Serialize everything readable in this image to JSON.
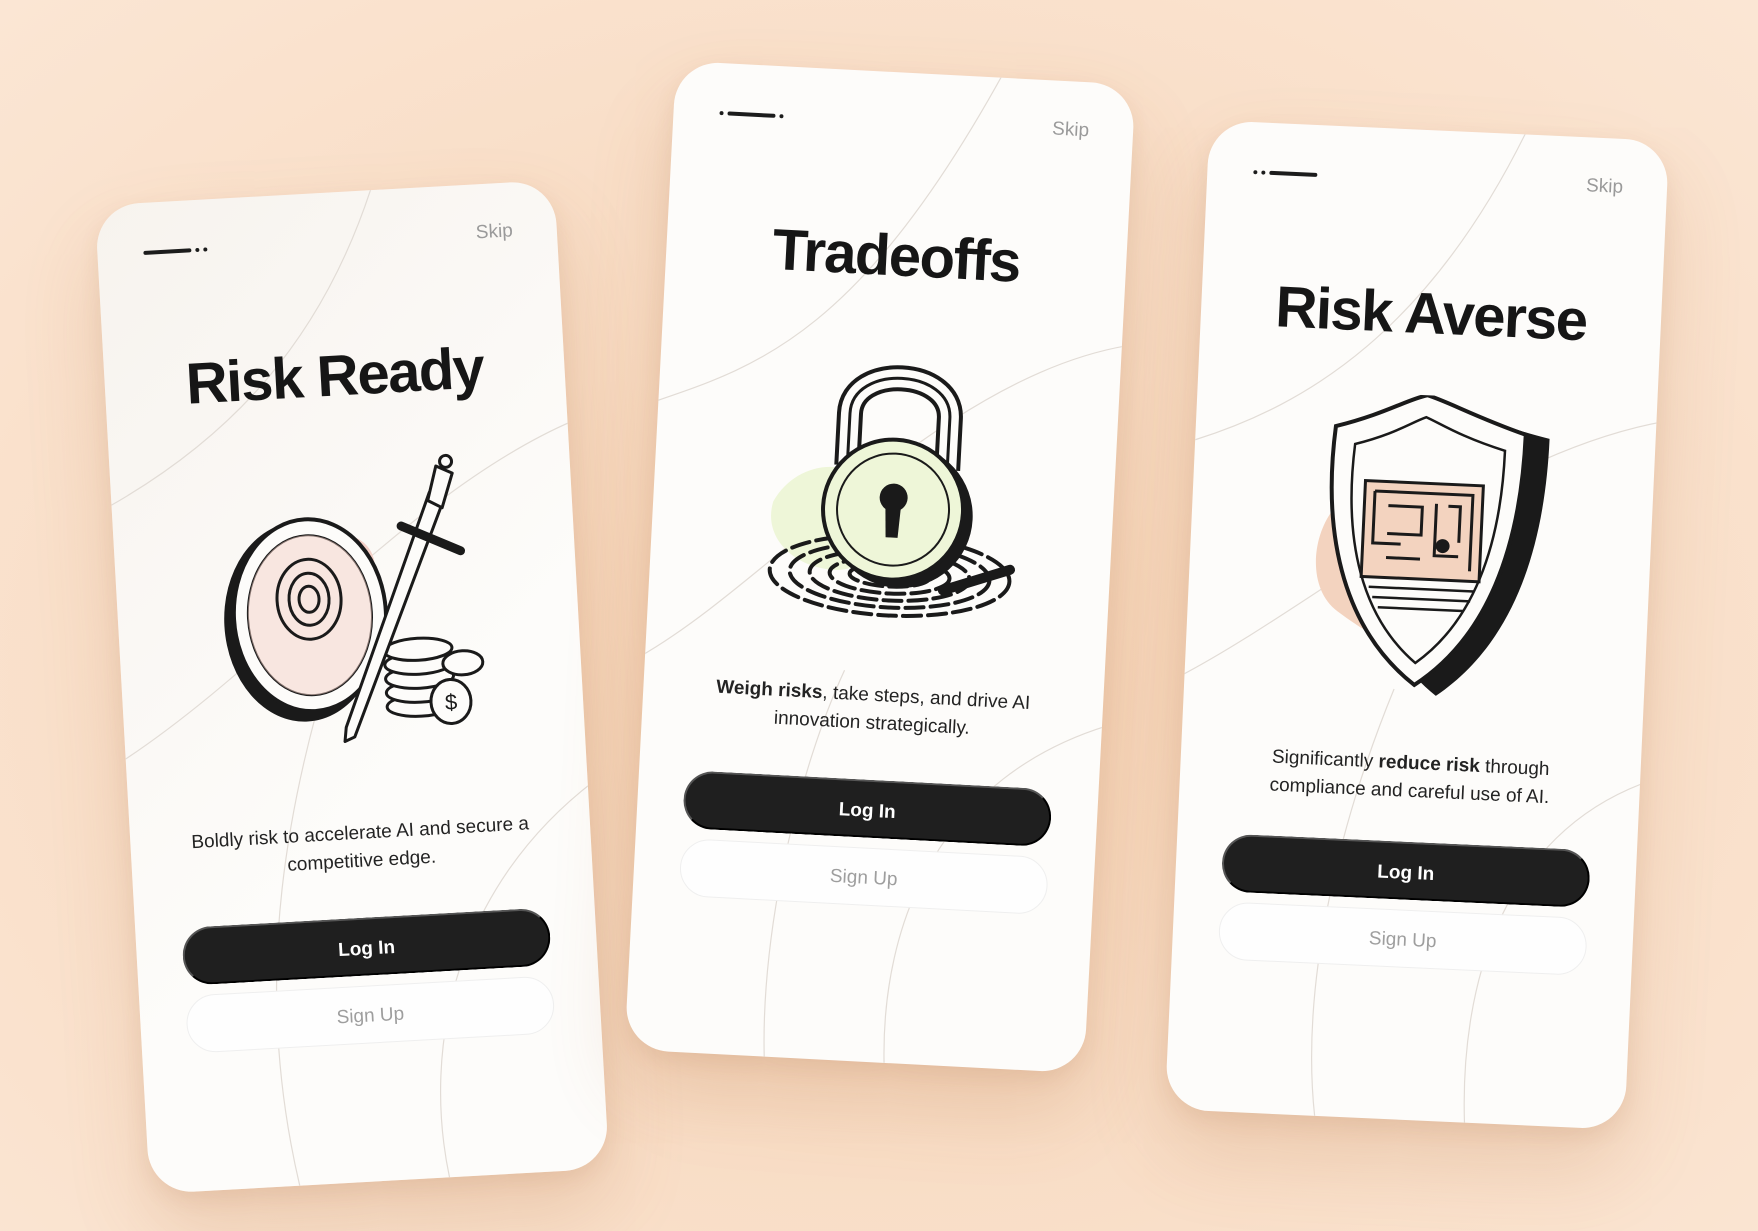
{
  "screens": [
    {
      "skip_label": "Skip",
      "title": "Risk Ready",
      "illustration_icon": "shield-sword-coins-icon",
      "description": {
        "bold": "",
        "before": "",
        "after": "Boldly risk to accelerate AI and secure a competitive edge."
      },
      "login_label": "Log In",
      "signup_label": "Sign Up"
    },
    {
      "skip_label": "Skip",
      "title": "Tradeoffs",
      "illustration_icon": "padlock-fingerprint-icon",
      "description": {
        "before": "",
        "bold": "Weigh risks",
        "after": ", take steps, and drive AI innovation strategically."
      },
      "login_label": "Log In",
      "signup_label": "Sign Up"
    },
    {
      "skip_label": "Skip",
      "title": "Risk Averse",
      "illustration_icon": "shield-maze-icon",
      "description": {
        "before": "Significantly ",
        "bold": "reduce risk",
        "after": " through compliance and careful use of AI."
      },
      "login_label": "Log In",
      "signup_label": "Sign Up"
    }
  ],
  "colors": {
    "background": "#f8dcc4",
    "card": "#fdfcfa",
    "primary_button": "#1f1f1f",
    "accent_pink": "#f4cfc6",
    "accent_green": "#eef6d8",
    "accent_peach": "#f3d3bf"
  }
}
